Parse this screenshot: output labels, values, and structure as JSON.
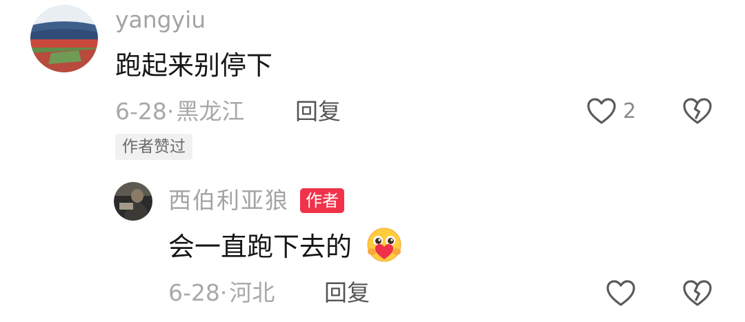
{
  "comment": {
    "username": "yangyiu",
    "text": "跑起来别停下",
    "date": "6-28",
    "separator": "·",
    "location": "黑龙江",
    "reply_label": "回复",
    "like_count": "2",
    "liked_by_author_label": "作者赞过",
    "avatar_icon": "stadium-avatar"
  },
  "reply": {
    "username": "西伯利亚狼",
    "author_badge": "作者",
    "text": "会一直跑下去的",
    "emoji_icon": "hug-heart-emoji",
    "date": "6-28",
    "separator": "·",
    "location": "河北",
    "reply_label": "回复",
    "avatar_icon": "person-avatar"
  },
  "colors": {
    "author_badge_bg": "#f0334a",
    "meta_gray": "#a8a8a8",
    "text_dark": "#161616"
  }
}
